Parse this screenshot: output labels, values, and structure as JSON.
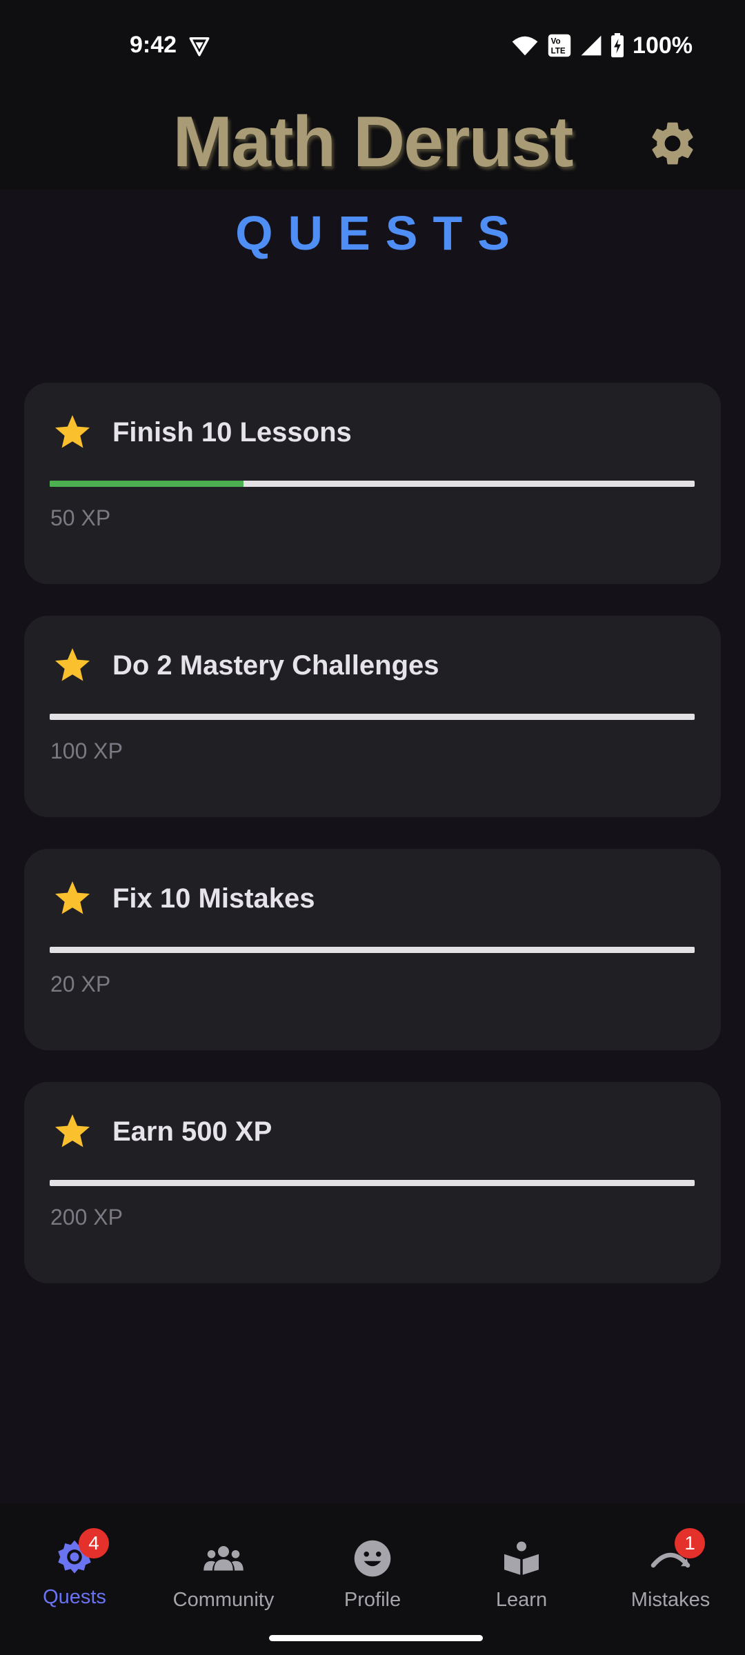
{
  "status_bar": {
    "time": "9:42",
    "battery": "100%",
    "icons": [
      "vpn-icon",
      "wifi-icon",
      "volte-icon",
      "signal-icon",
      "battery-charging-icon"
    ]
  },
  "header": {
    "app_title": "Math Derust",
    "settings_icon": "gear-icon"
  },
  "section_heading": "QUESTS",
  "colors": {
    "title": "#a89b75",
    "heading": "#4f8ef4",
    "star": "#fbc02d",
    "progress_fill": "#4caf50",
    "progress_track": "#e3e1e4",
    "nav_active": "#6a73f0",
    "badge": "#e5312c"
  },
  "quests": [
    {
      "title": "Finish 10 Lessons",
      "reward": "50 XP",
      "progress": 0.3,
      "icon": "star-icon"
    },
    {
      "title": "Do 2 Mastery Challenges",
      "reward": "100 XP",
      "progress": 0,
      "icon": "star-icon"
    },
    {
      "title": "Fix 10 Mistakes",
      "reward": "20 XP",
      "progress": 0,
      "icon": "star-icon"
    },
    {
      "title": "Earn 500 XP",
      "reward": "200 XP",
      "progress": 0,
      "icon": "star-icon"
    }
  ],
  "nav": [
    {
      "label": "Quests",
      "icon": "quests-gear-icon",
      "badge": "4",
      "active": true
    },
    {
      "label": "Community",
      "icon": "community-icon",
      "badge": "",
      "active": false
    },
    {
      "label": "Profile",
      "icon": "smiley-icon",
      "badge": "",
      "active": false
    },
    {
      "label": "Learn",
      "icon": "book-icon",
      "badge": "",
      "active": false
    },
    {
      "label": "Mistakes",
      "icon": "mistakes-icon",
      "badge": "1",
      "active": false
    }
  ]
}
